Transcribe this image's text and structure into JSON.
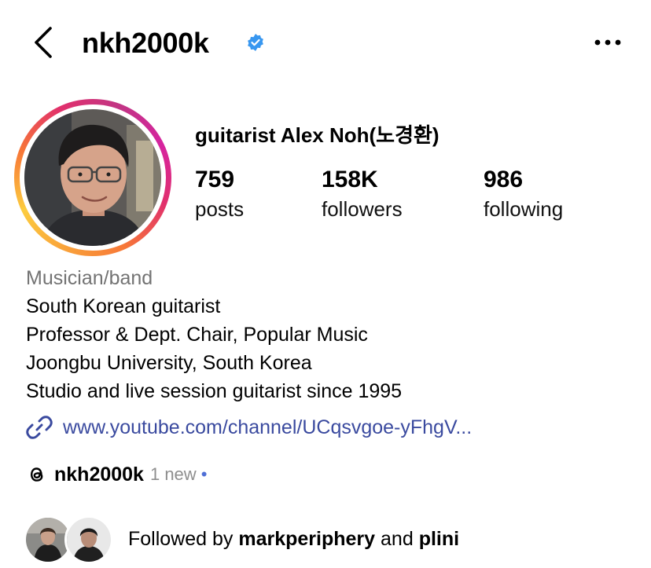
{
  "header": {
    "username": "nkh2000k",
    "verified_color": "#3897f0"
  },
  "profile": {
    "full_name": "guitarist Alex Noh(노경환)",
    "stats": {
      "posts": {
        "value": "759",
        "label": "posts"
      },
      "followers": {
        "value": "158K",
        "label": "followers"
      },
      "following": {
        "value": "986",
        "label": "following"
      }
    },
    "category": "Musician/band",
    "bio": [
      "South Korean guitarist",
      "Professor & Dept. Chair, Popular Music",
      "Joongbu University, South Korea",
      "Studio and live session guitarist since 1995"
    ],
    "link": "www.youtube.com/channel/UCqsvgoe-yFhgV..."
  },
  "threads": {
    "name": "nkh2000k",
    "badge": "1 new",
    "dot": "•"
  },
  "followed_by": {
    "prefix": "Followed by",
    "user1": "markperiphery",
    "conjunction": "and",
    "user2": "plini"
  },
  "icons": {
    "back": "chevron-left-icon",
    "verified": "verified-badge-icon",
    "more": "more-horizontal-icon",
    "link": "link-icon",
    "threads": "threads-icon"
  },
  "colors": {
    "link": "#3a4a9f",
    "muted": "#737373",
    "ring": [
      "#f9a13a",
      "#e1306c",
      "#c13584"
    ]
  }
}
